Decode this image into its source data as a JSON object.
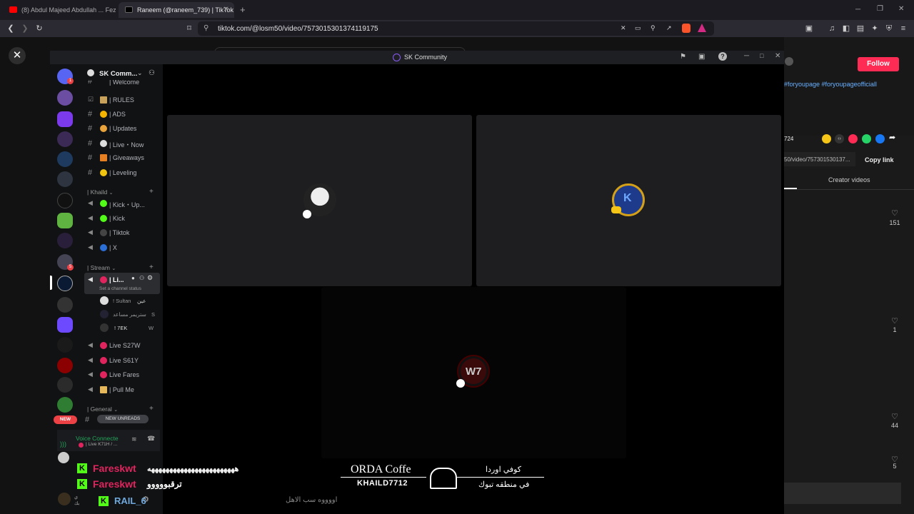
{
  "browser": {
    "tabs": [
      {
        "title": "(8) Abdul Majeed Abdullah ... Fezi La",
        "active": false,
        "fav_color": "#ff0000"
      },
      {
        "title": "Raneem (@raneem_739) | TikTok",
        "active": true,
        "fav_color": "#000000"
      }
    ],
    "new_tab_label": "+",
    "url": "tiktok.com/@losm50/video/7573015301374119175"
  },
  "tiktok": {
    "close_label": "✕",
    "follow_label": "Follow",
    "hashtags": "#foryoupage #foryoupageofficiall",
    "count_724": "724",
    "link_text": "50/video/757301530137...",
    "copy_link_label": "Copy link",
    "creator_videos_label": "Creator videos",
    "likes": [
      "151",
      "1",
      "44",
      "5"
    ]
  },
  "discord": {
    "window_title": "SK Community",
    "server_name": "SK Comm...",
    "channels_top": [
      {
        "label": "| Welcome",
        "icon": "#"
      },
      {
        "label": "| RULES",
        "icon": "☑"
      },
      {
        "label": "| ADS",
        "icon": "#"
      },
      {
        "label": "| Updates",
        "icon": "#"
      },
      {
        "label": "| Live・Now",
        "icon": "#"
      },
      {
        "label": "| Giveaways",
        "icon": "#"
      },
      {
        "label": "| Leveling",
        "icon": "#"
      }
    ],
    "cat_khaild": "| Khaild",
    "channels_khaild": [
      {
        "label": "| Kick・Up..."
      },
      {
        "label": "| Kick"
      },
      {
        "label": "| Tiktok"
      },
      {
        "label": "| X"
      }
    ],
    "cat_stream": "| Stream",
    "stream_active": "| Li...",
    "set_status": "Set a channel status",
    "voice_users": [
      "! Sultan",
      "ستريمر مساعد",
      "! 7EK"
    ],
    "voice_user_tags": [
      "عين",
      "S",
      "W"
    ],
    "channels_stream": [
      {
        "label": "Live S27W"
      },
      {
        "label": "Live S61Y"
      },
      {
        "label": "Live Fares"
      },
      {
        "label": "| Pull Me"
      }
    ],
    "cat_general": "| General",
    "new_unreads": "NEW UNREADS",
    "voice_connected": "Voice Connecte",
    "voice_channel": "| Live K71H / ...",
    "new_label": "NEW"
  },
  "overlay": {
    "chat": [
      {
        "user": "Fareskwt",
        "msg": "ههههههههههههههههههههههههه"
      },
      {
        "user": "Fareskwt",
        "msg": "ترقبووووو"
      },
      {
        "user": "RAIL_6",
        "msg": ""
      }
    ],
    "sub_msg": "اووووه سب الاهل",
    "brand_en": "ORDA Coffe",
    "brand_tag": "KHAILD7712",
    "brand_ar": "كوفي اوردا",
    "brand_ar_sub": "في منطقه تبوك",
    "bottom_tags": [
      "عين",
      "ي",
      "بك"
    ]
  }
}
